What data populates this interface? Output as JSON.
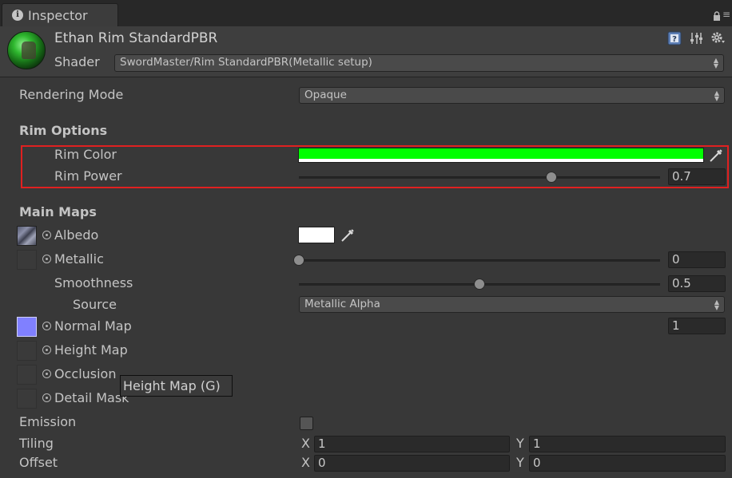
{
  "tab": {
    "title": "Inspector",
    "icon": "info-icon"
  },
  "header": {
    "material_name": "Ethan Rim StandardPBR",
    "shader_label": "Shader",
    "shader_value": "SwordMaster/Rim StandardPBR(Metallic setup)"
  },
  "rendering_mode": {
    "label": "Rendering Mode",
    "value": "Opaque"
  },
  "rim_options": {
    "title": "Rim Options",
    "color_label": "Rim Color",
    "color_value": "#00ff00",
    "power_label": "Rim Power",
    "power_value": "0.7",
    "power_fraction": 0.7
  },
  "main_maps": {
    "title": "Main Maps",
    "albedo": {
      "label": "Albedo",
      "color": "#ffffff"
    },
    "metallic": {
      "label": "Metallic",
      "value": "0",
      "fraction": 0.0
    },
    "smoothness": {
      "label": "Smoothness",
      "value": "0.5",
      "fraction": 0.5
    },
    "source": {
      "label": "Source",
      "value": "Metallic Alpha"
    },
    "normal_map": {
      "label": "Normal Map",
      "value": "1",
      "swatch_color": "#8080ff"
    },
    "height_map": {
      "label": "Height Map"
    },
    "occlusion": {
      "label": "Occlusion"
    },
    "detail_mask": {
      "label": "Detail Mask"
    },
    "tooltip": "Height Map (G)"
  },
  "emission": {
    "label": "Emission",
    "checked": false
  },
  "tiling": {
    "label": "Tiling",
    "x_label": "X",
    "x": "1",
    "y_label": "Y",
    "y": "1"
  },
  "offset": {
    "label": "Offset",
    "x_label": "X",
    "x": "0",
    "y_label": "Y",
    "y": "0"
  },
  "colors": {
    "highlight": "#e02020",
    "rim": "#00ff00"
  }
}
